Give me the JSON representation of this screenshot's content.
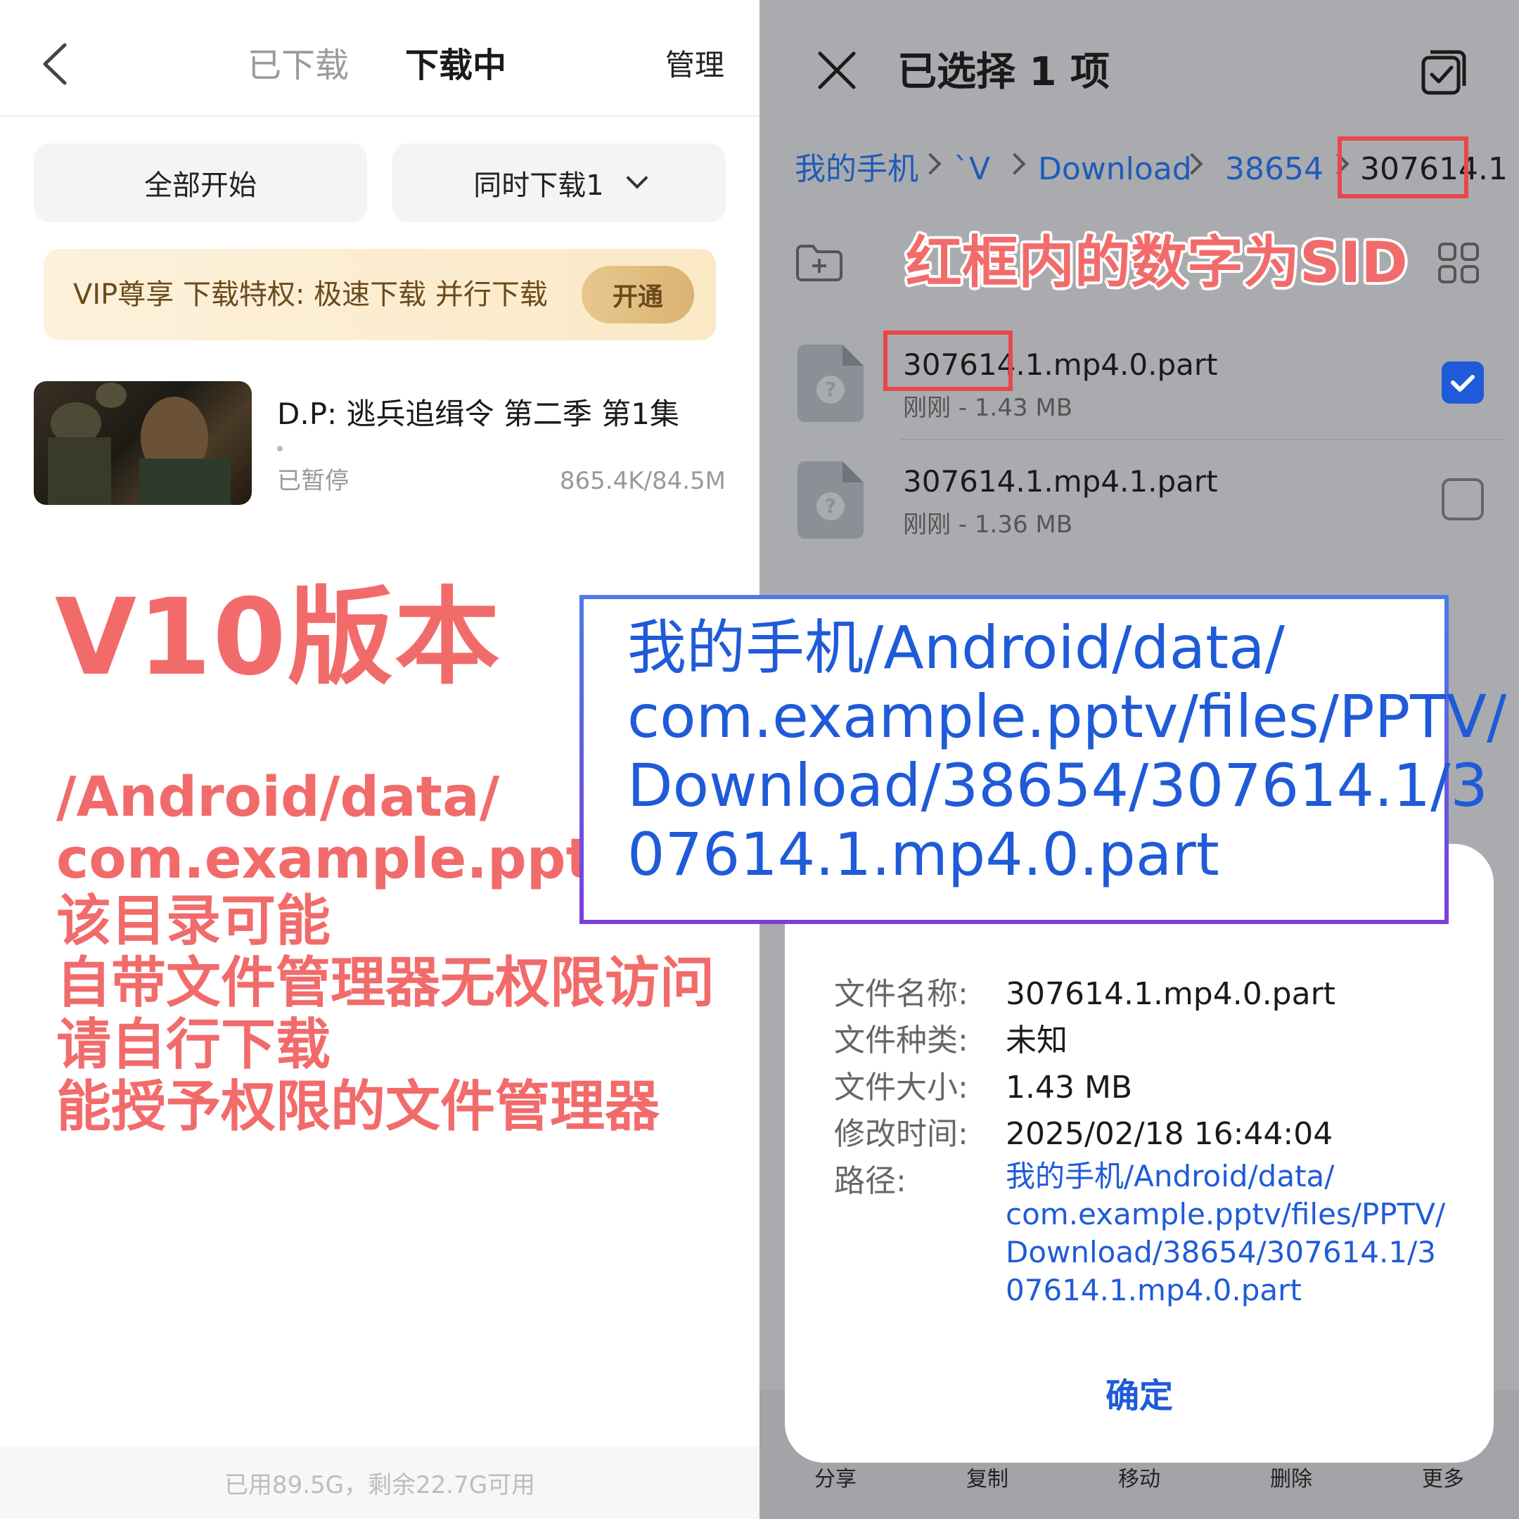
{
  "left": {
    "tabs": {
      "downloaded": "已下载",
      "downloading": "下载中"
    },
    "manage": "管理",
    "btn_start_all": "全部开始",
    "btn_concurrent": "同时下载1",
    "vip_text": "VIP尊享 下载特权: 极速下载 并行下载",
    "vip_btn": "开通",
    "item": {
      "title": "D.P:  逃兵追缉令 第二季 第1集",
      "status": "已暂停",
      "size": "865.4K/84.5M"
    },
    "storage": "已用89.5G，剩余22.7G可用"
  },
  "overlay": {
    "version": "V10版本",
    "note_lines": [
      "/Android/data/",
      "com.example.pptv",
      "该目录可能",
      "自带文件管理器无权限访问",
      "请自行下载",
      "能授予权限的文件管理器"
    ],
    "sid_label": "红框内的数字为SID",
    "callout_lines": [
      "我的手机/Android/data/",
      "com.example.pptv/files/PPTV/",
      "Download/38654/307614.1/3",
      "07614.1.mp4.0.part"
    ]
  },
  "right": {
    "title": "已选择 1 项",
    "breadcrumb": [
      "我的手机",
      "`V",
      "Download",
      "38654",
      "307614.1"
    ],
    "files": [
      {
        "name": "307614.1.mp4.0.part",
        "meta": "刚刚 - 1.43 MB",
        "checked": true
      },
      {
        "name": "307614.1.mp4.1.part",
        "meta": "刚刚 - 1.36 MB",
        "checked": false
      }
    ],
    "bottom_bar": [
      "分享",
      "复制",
      "移动",
      "删除",
      "更多"
    ]
  },
  "dialog": {
    "labels": {
      "name": "文件名称:",
      "type": "文件种类:",
      "size": "文件大小:",
      "time": "修改时间:",
      "path": "路径:"
    },
    "values": {
      "name": "307614.1.mp4.0.part",
      "type": "未知",
      "size": "1.43 MB",
      "time": "2025/02/18 16:44:04"
    },
    "path_lines": [
      "我的手机/Android/data/",
      "com.example.pptv/files/PPTV/",
      "Download/38654/307614.1/3",
      "07614.1.mp4.0.part"
    ],
    "ok": "确定"
  },
  "colors": {
    "accent_blue": "#1f5bd8",
    "red": "#f26b6b",
    "box_red": "#e8474a"
  }
}
